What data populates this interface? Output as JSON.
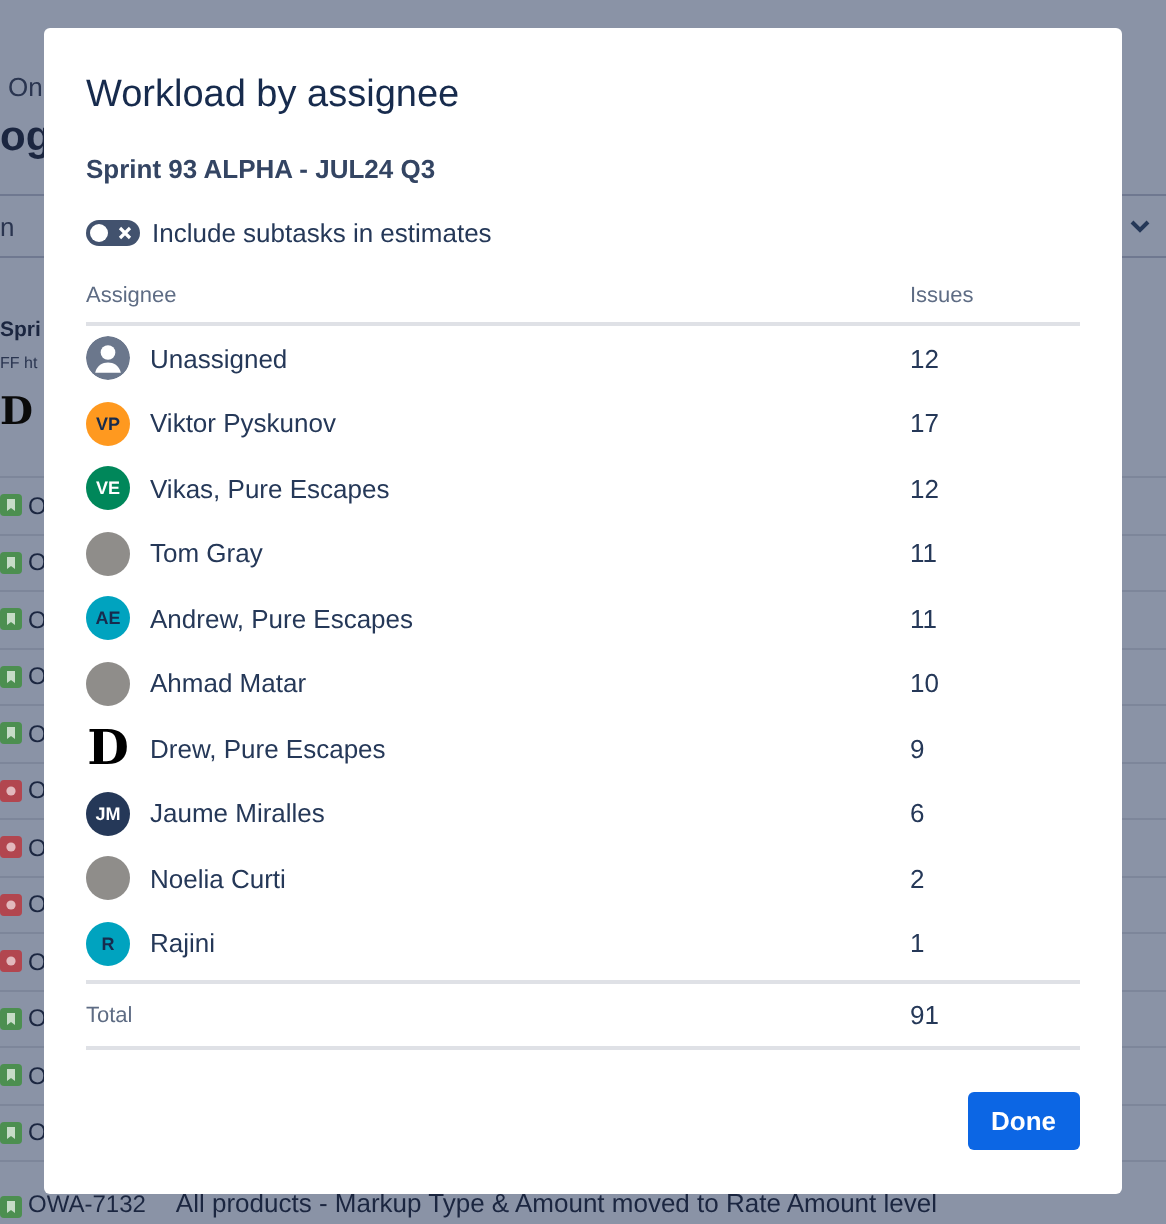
{
  "background": {
    "breadcrumb": "On",
    "title": "og",
    "search": "n",
    "sprint": "Spri",
    "sprint_note": "FF ht",
    "logo": "D",
    "issues": [
      {
        "kind": "story",
        "key": "O"
      },
      {
        "kind": "story",
        "key": "O"
      },
      {
        "kind": "story",
        "key": "O"
      },
      {
        "kind": "story",
        "key": "O"
      },
      {
        "kind": "story",
        "key": "O"
      },
      {
        "kind": "bug",
        "key": "O"
      },
      {
        "kind": "bug",
        "key": "O"
      },
      {
        "kind": "bug",
        "key": "O"
      },
      {
        "kind": "bug",
        "key": "O"
      },
      {
        "kind": "story",
        "key": "O"
      },
      {
        "kind": "story",
        "key": "O"
      },
      {
        "kind": "story",
        "key": "O"
      },
      {
        "kind": "story",
        "key": "OWA-7132",
        "summary": "All products - Markup Type & Amount moved to Rate Amount level"
      }
    ]
  },
  "dialog": {
    "title": "Workload by assignee",
    "sprint": "Sprint 93 ALPHA - JUL24 Q3",
    "toggle": {
      "label": "Include subtasks in estimates",
      "on": false
    },
    "columns": [
      "Assignee",
      "Issues"
    ],
    "rows": [
      {
        "kind": "unassigned",
        "name": "Unassigned",
        "issues": "12"
      },
      {
        "kind": "initials",
        "initials": "VP",
        "color": "#ff991f",
        "name": "Viktor Pyskunov",
        "issues": "17"
      },
      {
        "kind": "initials",
        "initials": "VE",
        "color": "#00875a",
        "name": "Vikas, Pure Escapes",
        "issues": "12"
      },
      {
        "kind": "photo",
        "name": "Tom Gray",
        "issues": "11"
      },
      {
        "kind": "initials",
        "initials": "AE",
        "color": "#00a3bf",
        "name": "Andrew, Pure Escapes",
        "issues": "11"
      },
      {
        "kind": "photo",
        "name": "Ahmad Matar",
        "issues": "10"
      },
      {
        "kind": "logo",
        "initials": "D",
        "name": "Drew, Pure Escapes",
        "issues": "9"
      },
      {
        "kind": "initials",
        "initials": "JM",
        "color": "#253858",
        "name": "Jaume Miralles",
        "issues": "6"
      },
      {
        "kind": "photo",
        "name": "Noelia Curti",
        "issues": "2"
      },
      {
        "kind": "initials",
        "initials": "R",
        "color": "#00a3bf",
        "name": "Rajini",
        "issues": "1"
      }
    ],
    "total": {
      "label": "Total",
      "issues": "91"
    },
    "button": "Done"
  }
}
